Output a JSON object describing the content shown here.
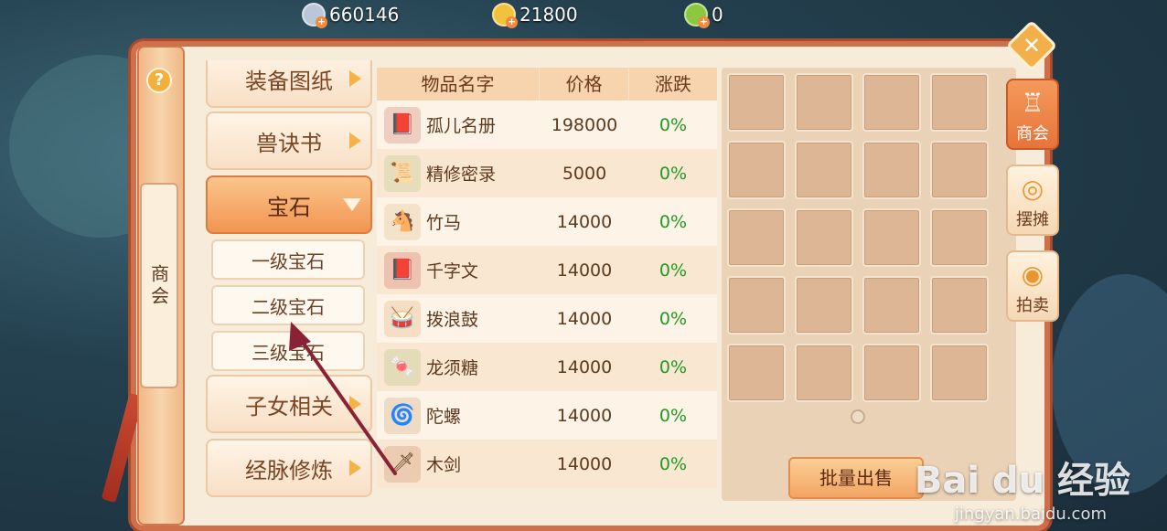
{
  "currency": {
    "silver": "660146",
    "gold": "21800",
    "jade": "0"
  },
  "banner": {
    "help": "?",
    "title": "商会"
  },
  "categories": [
    {
      "label": "装备图纸"
    },
    {
      "label": "兽诀书"
    },
    {
      "label": "宝石"
    },
    {
      "label": "子女相关"
    },
    {
      "label": "经脉修炼"
    }
  ],
  "subcategories": [
    {
      "label": "一级宝石"
    },
    {
      "label": "二级宝石"
    },
    {
      "label": "三级宝石"
    }
  ],
  "table": {
    "headers": {
      "name": "物品名字",
      "price": "价格",
      "change": "涨跌"
    },
    "rows": [
      {
        "name": "孤儿名册",
        "price": "198000",
        "change": "0%",
        "icon": "book-icon"
      },
      {
        "name": "精修密录",
        "price": "5000",
        "change": "0%",
        "icon": "scroll-icon"
      },
      {
        "name": "竹马",
        "price": "14000",
        "change": "0%",
        "icon": "bamboo-horse-icon"
      },
      {
        "name": "千字文",
        "price": "14000",
        "change": "0%",
        "icon": "red-book-icon"
      },
      {
        "name": "拨浪鼓",
        "price": "14000",
        "change": "0%",
        "icon": "drum-icon"
      },
      {
        "name": "龙须糖",
        "price": "14000",
        "change": "0%",
        "icon": "candy-icon"
      },
      {
        "name": "陀螺",
        "price": "14000",
        "change": "0%",
        "icon": "top-icon"
      },
      {
        "name": "木剑",
        "price": "14000",
        "change": "0%",
        "icon": "wooden-sword-icon"
      }
    ]
  },
  "inventory": {
    "sell_button": "批量出售"
  },
  "side_tabs": [
    {
      "label": "商会",
      "active": true
    },
    {
      "label": "摆摊",
      "active": false
    },
    {
      "label": "拍卖",
      "active": false
    }
  ],
  "watermark": {
    "main": "Bai du 经验",
    "sub": "jingyan.baidu.com"
  }
}
